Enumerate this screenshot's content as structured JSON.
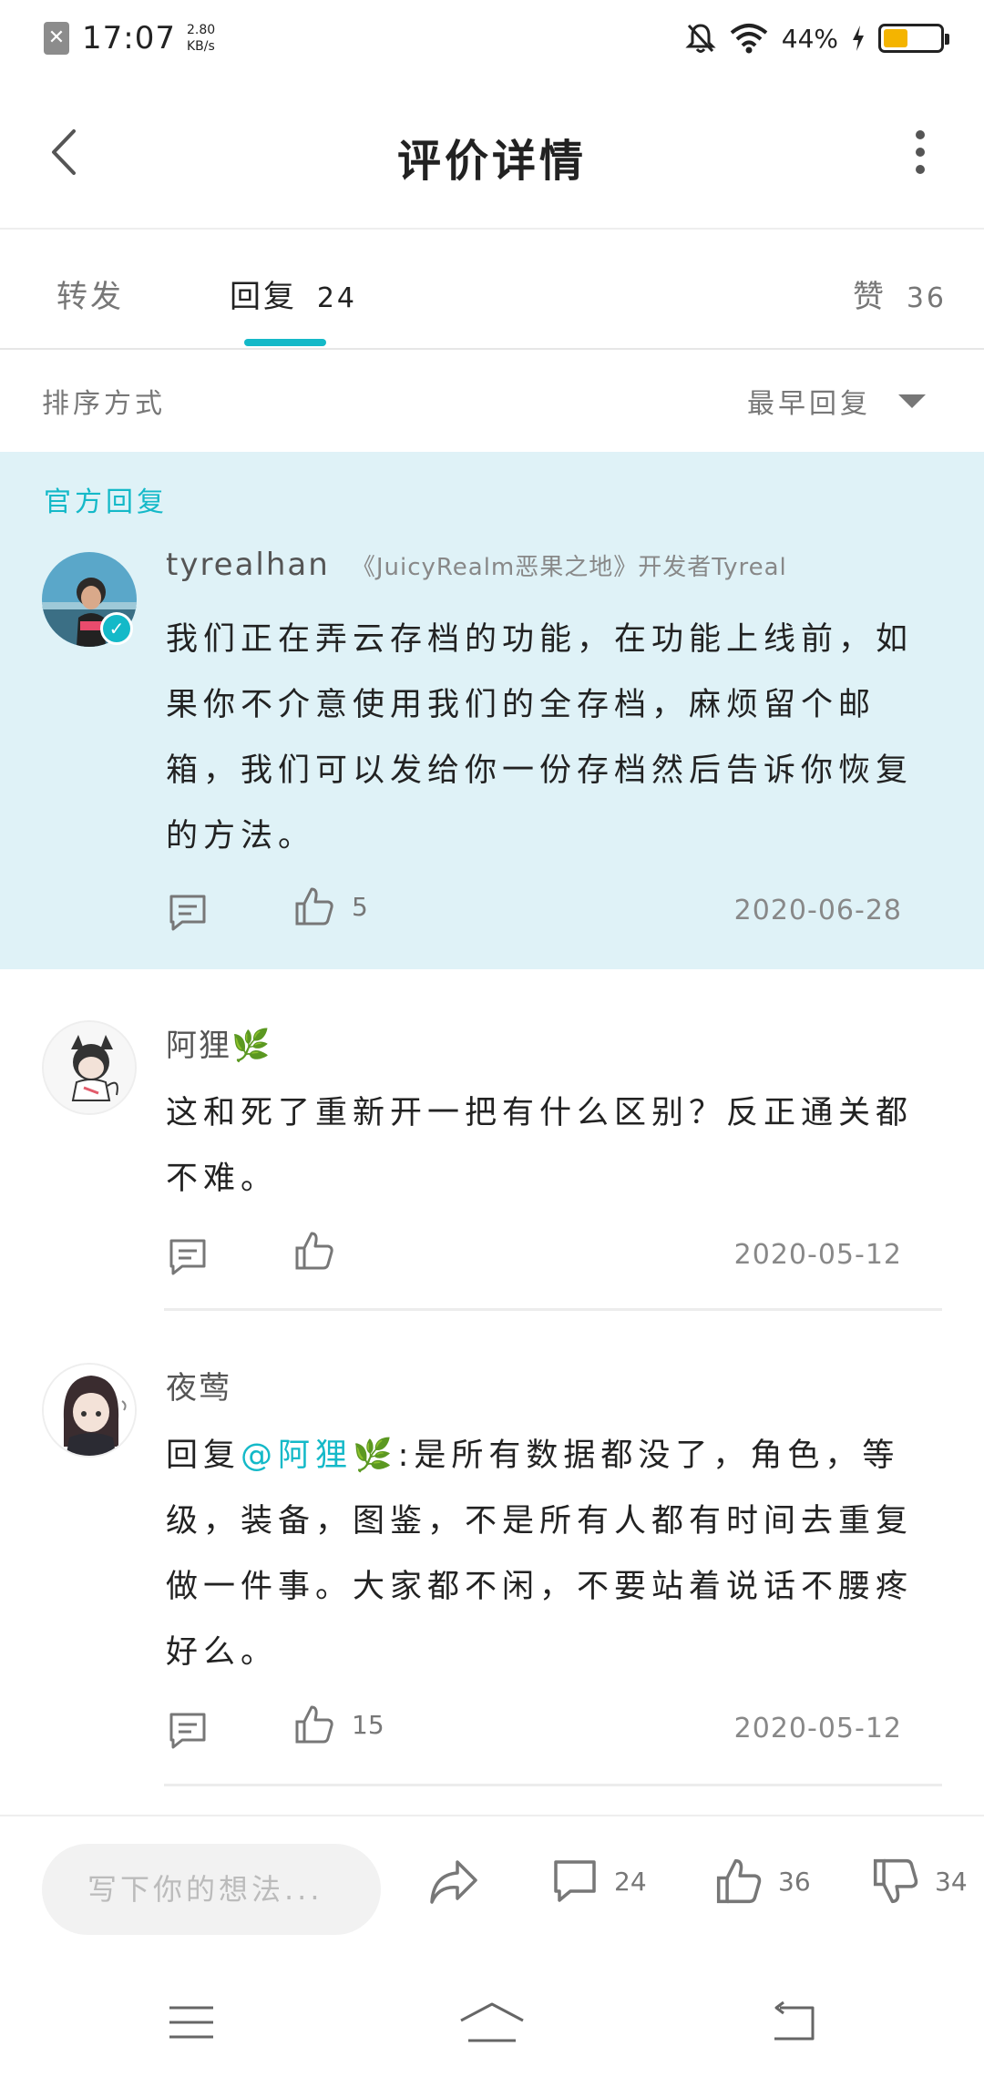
{
  "status_bar": {
    "time": "17:07",
    "net_speed_value": "2.80",
    "net_speed_unit": "KB/s",
    "battery_percent": "44%",
    "battery_level": 0.44,
    "battery_color": "#f4b400",
    "icons": [
      "notification-blocked-icon",
      "mute-icon",
      "wifi-icon",
      "charging-icon",
      "battery-icon"
    ]
  },
  "header": {
    "title": "评价详情"
  },
  "tabs": [
    {
      "label": "转发",
      "count": ""
    },
    {
      "label": "回复",
      "count": "24"
    },
    {
      "label": "赞",
      "count": "36"
    }
  ],
  "sort": {
    "label": "排序方式",
    "selected": "最早回复"
  },
  "official_section_label": "官方回复",
  "comments": [
    {
      "username": "tyrealhan",
      "dev_tag": "《JuicyRealm恶果之地》开发者Tyreal",
      "text": "我们正在弄云存档的功能，在功能上线前，如果你不介意使用我们的全存档，麻烦留个邮箱，我们可以发给你一份存档然后告诉你恢复的方法。",
      "likes": "5",
      "date": "2020-06-28"
    },
    {
      "username": "阿狸🌿",
      "text": "这和死了重新开一把有什么区别？反正通关都不难。",
      "likes": "",
      "date": "2020-05-12"
    },
    {
      "username": "夜莺",
      "reply_prefix": "回复",
      "mention": "@阿狸🌿",
      "text": ":是所有数据都没了，角色，等级，装备，图鉴，不是所有人都有时间去重复做一件事。大家都不闲，不要站着说话不腰疼好么。",
      "likes": "15",
      "date": "2020-05-12"
    }
  ],
  "bottom_bar": {
    "input_placeholder": "写下你的想法...",
    "comment_count": "24",
    "like_count": "36",
    "dislike_count": "34"
  },
  "colors": {
    "accent": "#14b9c8",
    "official_bg": "#dff2f7"
  }
}
